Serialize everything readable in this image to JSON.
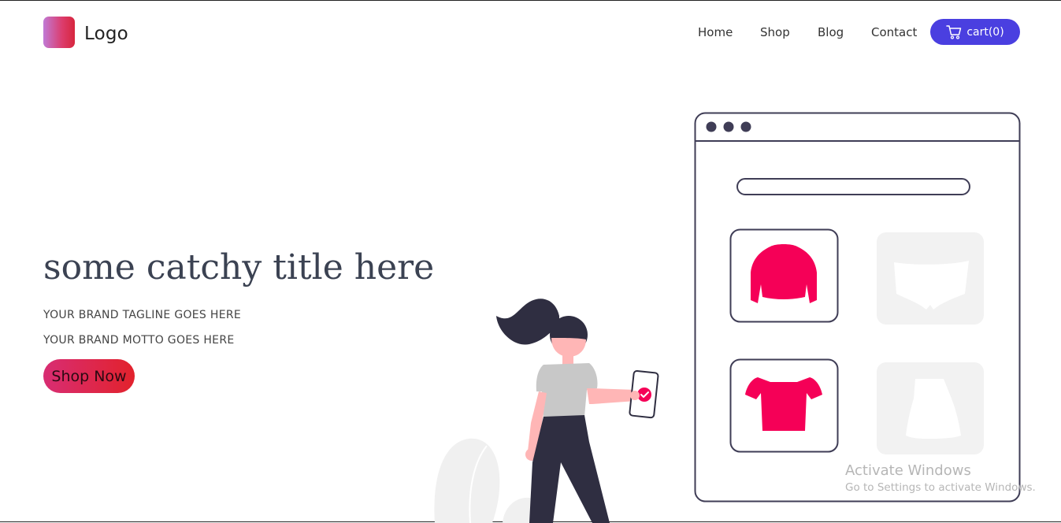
{
  "header": {
    "logo_text": "Logo",
    "nav": [
      {
        "label": "Home"
      },
      {
        "label": "Shop"
      },
      {
        "label": "Blog"
      },
      {
        "label": "Contact"
      }
    ],
    "cart_label": "cart(0)"
  },
  "hero": {
    "title": "some catchy title here",
    "tagline": "YOUR BRAND TAGLINE GOES HERE",
    "motto": "YOUR BRAND MOTTO GOES HERE",
    "cta_label": "Shop Now"
  },
  "illustration": {
    "product_cards": [
      {
        "item": "sweater",
        "state": "active"
      },
      {
        "item": "shorts",
        "state": "faded"
      },
      {
        "item": "crop-top",
        "state": "active"
      },
      {
        "item": "skirt",
        "state": "faded"
      }
    ]
  },
  "watermark": {
    "line1": "Activate Windows",
    "line2": "Go to Settings to activate Windows."
  },
  "colors": {
    "accent_blue": "#4a3fe0",
    "accent_pink": "#f50057",
    "dark": "#2f2e41",
    "skin": "#ffb6b6"
  },
  "icons": {
    "cart": "shopping-cart-icon",
    "logo": "gradient-square-logo-icon"
  }
}
